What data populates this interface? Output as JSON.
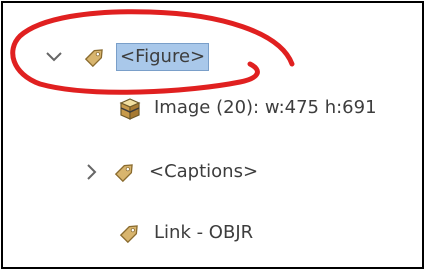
{
  "tree": {
    "items": [
      {
        "label": "<Figure>",
        "icon": "tag-icon",
        "expander": "chevron-down-icon",
        "selected": true
      },
      {
        "label": "Image (20): w:475 h:691",
        "icon": "image-box-icon"
      },
      {
        "label": "<Captions>",
        "icon": "tag-icon",
        "expander": "chevron-right-icon"
      },
      {
        "label": "Link - OBJR",
        "icon": "tag-icon"
      }
    ]
  },
  "colors": {
    "selection": "#a9c8ea",
    "annotation": "#e02020",
    "tag": "#c9a05a"
  }
}
